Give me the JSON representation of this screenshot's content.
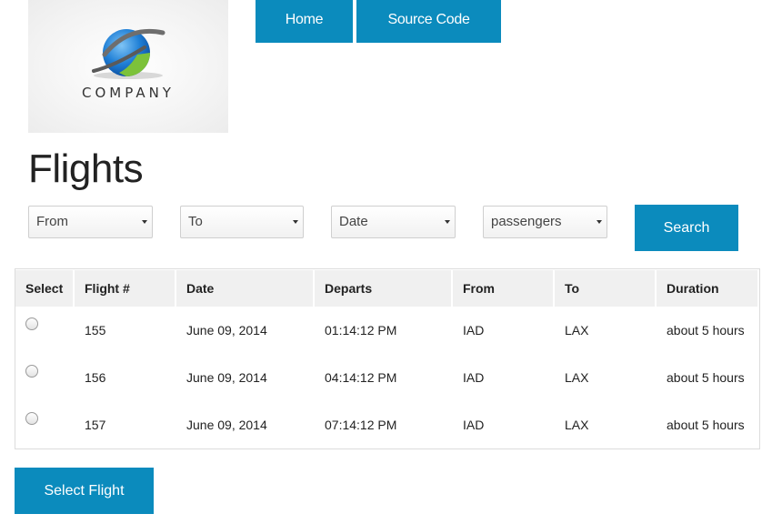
{
  "logo": {
    "text": "COMPANY"
  },
  "nav": {
    "home": "Home",
    "source_code": "Source Code"
  },
  "page_title": "Flights",
  "filters": {
    "from": "From",
    "to": "To",
    "date": "Date",
    "passengers": "passengers",
    "search_label": "Search"
  },
  "table": {
    "headers": [
      "Select",
      "Flight #",
      "Date",
      "Departs",
      "From",
      "To",
      "Duration"
    ],
    "rows": [
      {
        "flight": "155",
        "date": "June 09, 2014",
        "departs": "01:14:12 PM",
        "from": "IAD",
        "to": "LAX",
        "duration": "about 5 hours"
      },
      {
        "flight": "156",
        "date": "June 09, 2014",
        "departs": "04:14:12 PM",
        "from": "IAD",
        "to": "LAX",
        "duration": "about 5 hours"
      },
      {
        "flight": "157",
        "date": "June 09, 2014",
        "departs": "07:14:12 PM",
        "from": "IAD",
        "to": "LAX",
        "duration": "about 5 hours"
      }
    ]
  },
  "select_flight_label": "Select Flight",
  "colors": {
    "accent": "#0b8bbd",
    "header_bg": "#f0f0f0"
  }
}
